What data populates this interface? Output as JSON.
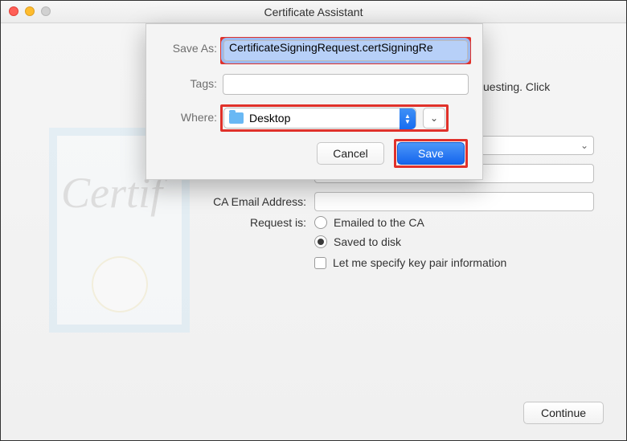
{
  "window": {
    "title": "Certificate Assistant"
  },
  "intro_tail": "uesting. Click",
  "form": {
    "ca_email_label": "CA Email Address:",
    "request_label": "Request is:",
    "radio_emailed": "Emailed to the CA",
    "radio_saved": "Saved to disk",
    "checkbox_keypair": "Let me specify key pair information"
  },
  "continue_label": "Continue",
  "sheet": {
    "saveas_label": "Save As:",
    "saveas_value": "CertificateSigningRequest.certSigningRe",
    "tags_label": "Tags:",
    "where_label": "Where:",
    "where_value": "Desktop",
    "cancel": "Cancel",
    "save": "Save"
  }
}
